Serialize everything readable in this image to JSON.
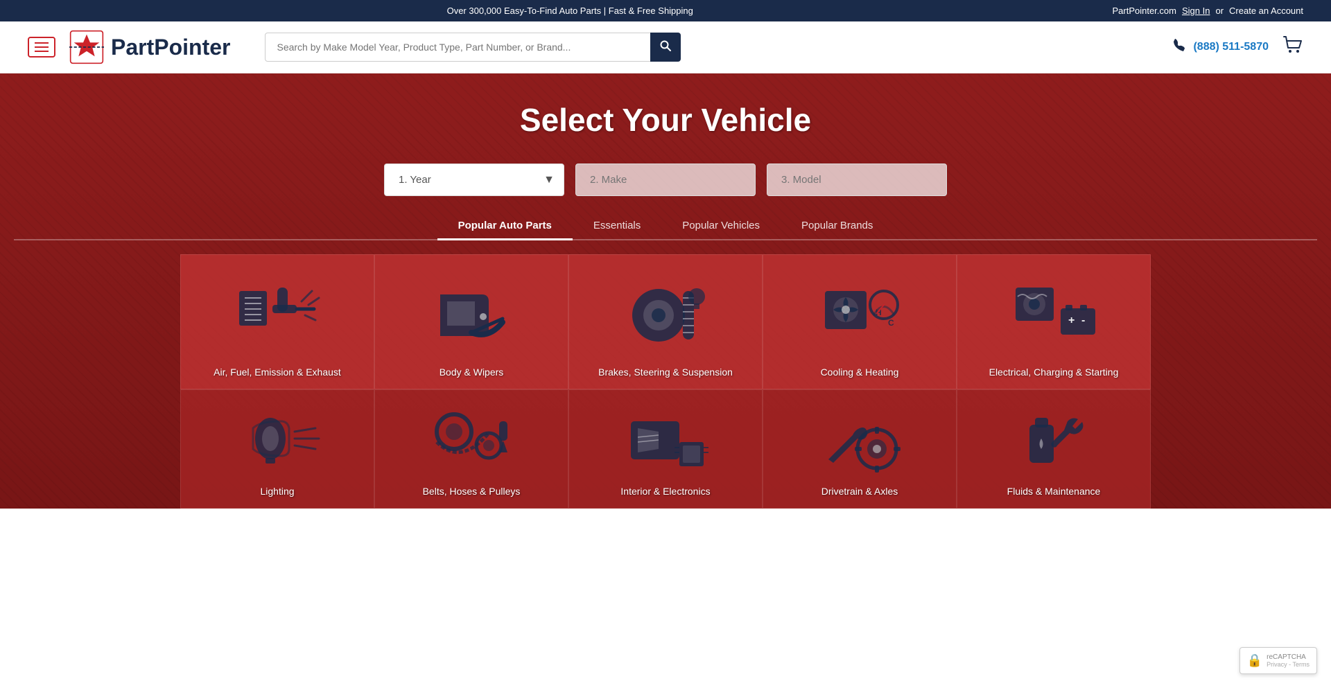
{
  "banner": {
    "left_text": "",
    "center_text": "Over 300,000 Easy-To-Find Auto Parts  |  Fast & Free Shipping",
    "site_name": "PartPointer.com",
    "signin_label": "Sign In",
    "or_text": "or",
    "create_account_label": "Create an Account"
  },
  "header": {
    "logo_text": "PartPointer",
    "search_placeholder": "Search by Make Model Year, Product Type, Part Number, or Brand...",
    "phone_number": "(888) 511-5870"
  },
  "hero": {
    "title": "Select Your Vehicle",
    "year_placeholder": "1. Year",
    "make_placeholder": "2. Make",
    "model_placeholder": "3. Model"
  },
  "tabs": [
    {
      "id": "popular-auto-parts",
      "label": "Popular Auto Parts",
      "active": true
    },
    {
      "id": "essentials",
      "label": "Essentials",
      "active": false
    },
    {
      "id": "popular-vehicles",
      "label": "Popular Vehicles",
      "active": false
    },
    {
      "id": "popular-brands",
      "label": "Popular Brands",
      "active": false
    }
  ],
  "part_categories": [
    {
      "id": "air-fuel",
      "label": "Air, Fuel, Emission & Exhaust"
    },
    {
      "id": "body-wipers",
      "label": "Body & Wipers"
    },
    {
      "id": "brakes",
      "label": "Brakes, Steering & Suspension"
    },
    {
      "id": "cooling",
      "label": "Cooling & Heating"
    },
    {
      "id": "electrical",
      "label": "Electrical, Charging & Starting"
    }
  ],
  "part_categories_row2": [
    {
      "id": "lighting",
      "label": "Lighting"
    },
    {
      "id": "belts",
      "label": "Belts, Hoses & Pulleys"
    },
    {
      "id": "interior",
      "label": "Interior & Electronics"
    },
    {
      "id": "drivetrain",
      "label": "Drivetrain & Axles"
    },
    {
      "id": "fluids",
      "label": "Fluids & Maintenance"
    }
  ],
  "recaptcha": {
    "label": "Privacy - Terms",
    "logo_text": "reCAPTCHA"
  }
}
